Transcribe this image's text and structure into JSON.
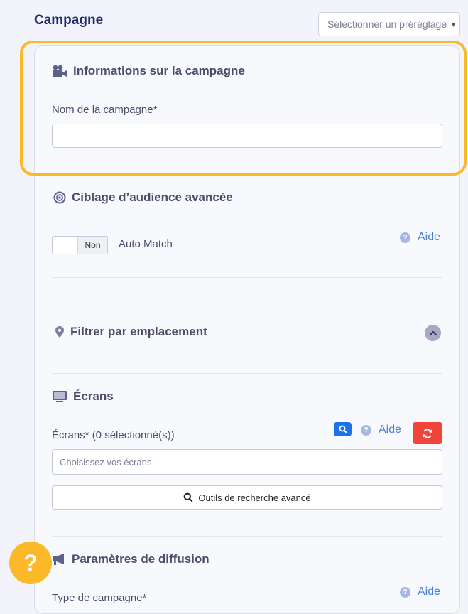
{
  "page": {
    "title": "Campagne",
    "preset_placeholder": "Sélectionner un préréglage",
    "preset_caret": "▾"
  },
  "campaign_info": {
    "title": "Informations sur la campagne",
    "icon": "video-camera-icon",
    "name_label": "Nom de la campagne*",
    "name_value": ""
  },
  "audience": {
    "title": "Ciblage d’audience avancée",
    "icon": "target-icon",
    "toggle_state": "Non",
    "toggle_label": "Auto Match",
    "help_label": "Aide",
    "help_icon_glyph": "?"
  },
  "location": {
    "title": "Filtrer par emplacement",
    "icon": "map-pin-icon",
    "collapse_icon": "chevron-up-icon"
  },
  "screens": {
    "title": "Écrans",
    "icon": "monitor-icon",
    "field_label": "Écrans* (0 sélectionné(s))",
    "help_label": "Aide",
    "help_icon_glyph": "?",
    "placeholder": "Choisissez vos écrans",
    "advanced_search_label": "Outils de recherche avancé"
  },
  "diffusion": {
    "title": "Paramètres de diffusion",
    "icon": "megaphone-icon",
    "type_label": "Type de campagne*",
    "help_label": "Aide",
    "help_icon_glyph": "?"
  },
  "fab": {
    "glyph": "?"
  },
  "colors": {
    "accent": "#fbb92a",
    "title": "#1f2a6b",
    "link": "#4a7fd4",
    "search_button": "#1a73e8",
    "reset_button": "#f0453a"
  }
}
